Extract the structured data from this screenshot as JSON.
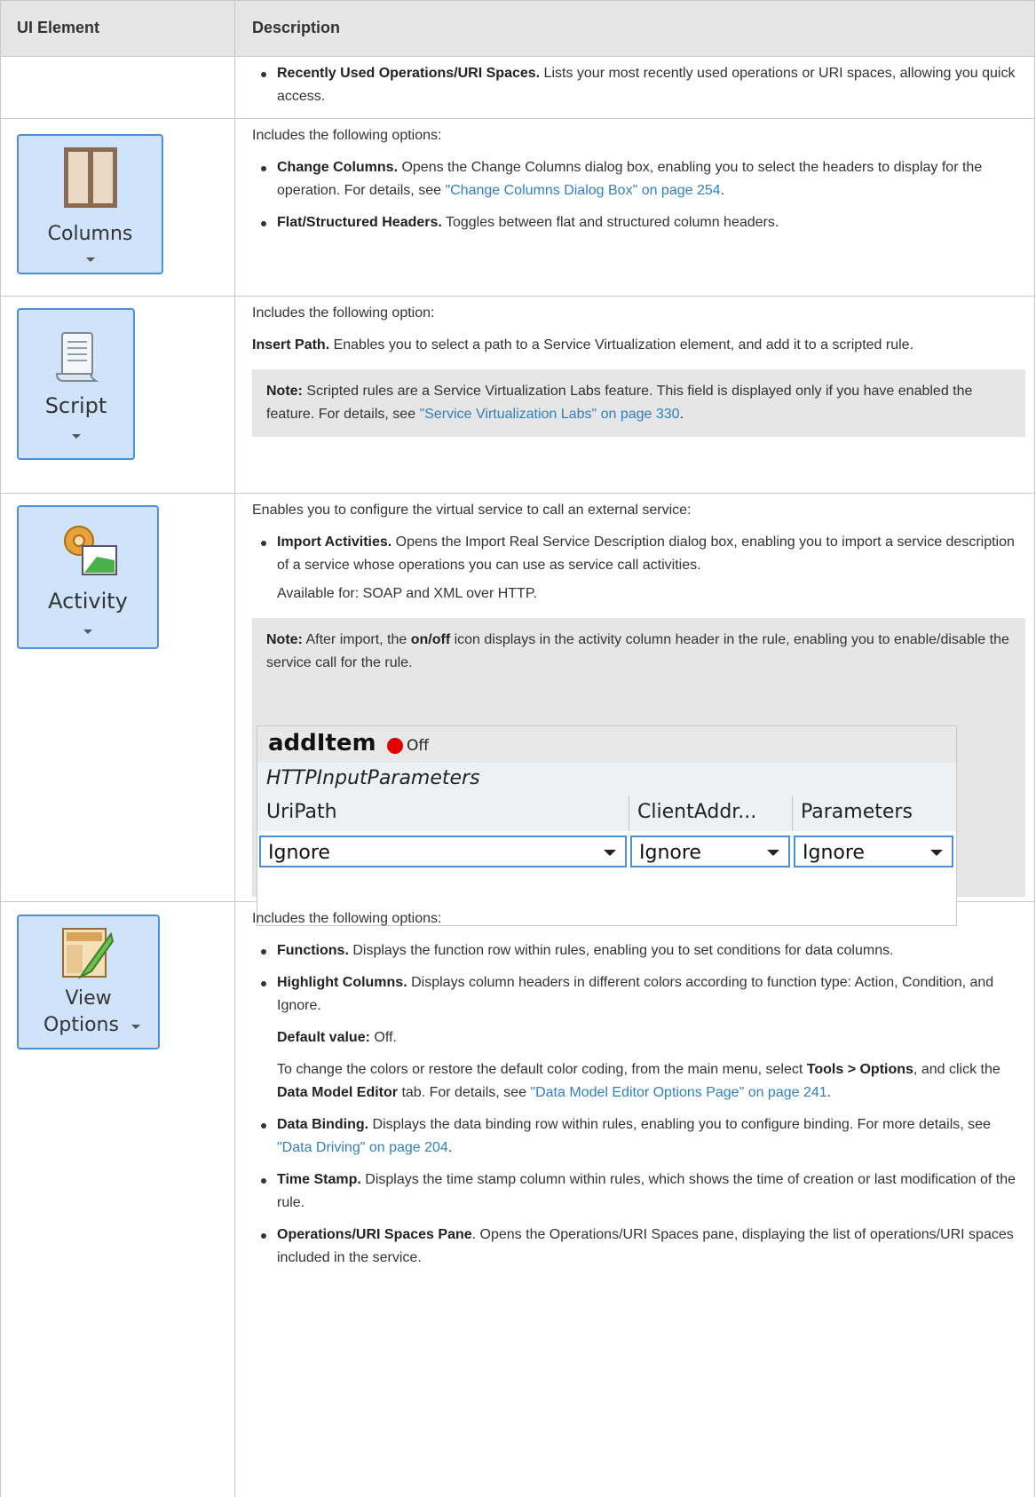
{
  "header": {
    "col1": "UI Element",
    "col2": "Description"
  },
  "row0": {
    "item_title": "Recently Used Operations/URI Spaces.",
    "item_text": " Lists your most recently used operations or URI spaces, allowing you quick access."
  },
  "row_columns": {
    "button_label": "Columns",
    "intro": "Includes the following options:",
    "items": [
      {
        "title": "Change Columns.",
        "text": " Opens the Change Columns dialog box, enabling you to select the headers to display for the operation. For details, see ",
        "link": "\"Change Columns Dialog Box\" on page 254",
        "after": "."
      },
      {
        "title": "Flat/Structured Headers.",
        "text": " Toggles between flat and structured column headers."
      }
    ]
  },
  "row_script": {
    "button_label": "Script",
    "intro": "Includes the following option:",
    "insert_title": "Insert Path.",
    "insert_text": " Enables you to select a path to a Service Virtualization element, and add it to a scripted rule.",
    "note_label": "Note:",
    "note_text": " Scripted rules are a Service Virtualization Labs feature. This field is displayed only if you have enabled the feature. For details, see ",
    "note_link": "\"Service Virtualization Labs\" on page 330",
    "note_after": "."
  },
  "row_activity": {
    "button_label": "Activity",
    "intro": "Enables you to configure the virtual service to call an external service:",
    "item_title": "Import Activities.",
    "item_text": " Opens the Import Real Service Description dialog box, enabling you to import a service description of a service whose operations you can use as service call activities.",
    "available": "Available for: SOAP and XML over HTTP.",
    "note_label": "Note:",
    "note_pre": " After import, the ",
    "note_bold": "on/off",
    "note_post": " icon displays in the activity column header in the rule, enabling you to enable/disable the service call for the rule.",
    "grid": {
      "operation": "addItem",
      "status": "Off",
      "group": "HTTPInputParameters",
      "columns": [
        "UriPath",
        "ClientAddr...",
        "Parameters"
      ],
      "values": [
        "Ignore",
        "Ignore",
        "Ignore"
      ]
    }
  },
  "row_view": {
    "button_label_1": "View",
    "button_label_2": "Options",
    "intro": "Includes the following options:",
    "functions_title": "Functions.",
    "functions_text": " Displays the function row within rules, enabling you to set conditions for data columns.",
    "highlight_title": "Highlight Columns.",
    "highlight_text": " Displays column headers in different colors according to function type: Action, Condition, and Ignore.",
    "default_label": "Default value:",
    "default_value": " Off.",
    "change_pre": "To change the colors or restore the default color coding, from the main menu, select ",
    "change_b1": "Tools > Options",
    "change_mid": ", and click the ",
    "change_b2": "Data Model Editor",
    "change_mid2": " tab. For details, see ",
    "change_link": "\"Data Model Editor Options Page\" on page 241",
    "change_after": ".",
    "binding_title": "Data Binding.",
    "binding_text": " Displays the data binding row within rules, enabling you to configure binding. For more details, see ",
    "binding_link": "\"Data Driving\" on page 204",
    "binding_after": ".",
    "timestamp_title": "Time Stamp.",
    "timestamp_text": " Displays the time stamp column within rules, which shows the time of creation or last modification of the rule.",
    "ops_title": "Operations/URI Spaces Pane",
    "ops_text": ". Opens the Operations/URI Spaces pane, displaying the list of operations/URI spaces included in the service."
  },
  "colors": {
    "link": "#2f7fc1",
    "header_bg": "#e6e6e6",
    "button_bg": "#cfe4fb",
    "button_border": "#4f8fd9",
    "status_red": "#e00000"
  }
}
